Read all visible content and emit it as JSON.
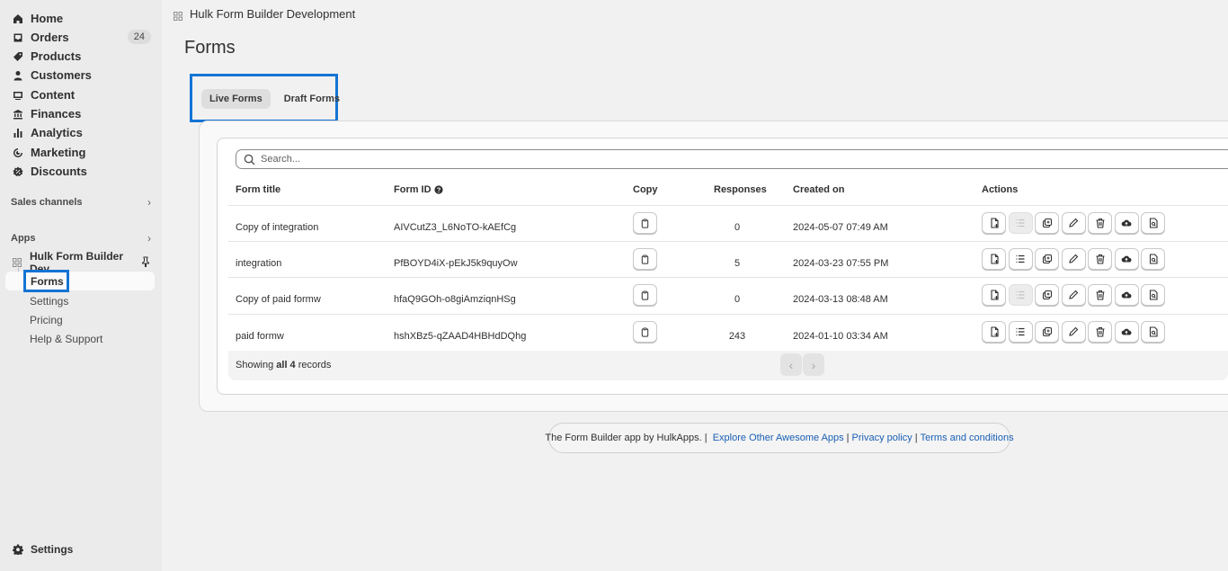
{
  "sidebar": {
    "nav": [
      {
        "label": "Home",
        "icon": "home-icon"
      },
      {
        "label": "Orders",
        "icon": "inbox-icon",
        "badge": "24"
      },
      {
        "label": "Products",
        "icon": "tag-icon"
      },
      {
        "label": "Customers",
        "icon": "person-icon"
      },
      {
        "label": "Content",
        "icon": "content-icon"
      },
      {
        "label": "Finances",
        "icon": "bank-icon"
      },
      {
        "label": "Analytics",
        "icon": "bar-chart-icon"
      },
      {
        "label": "Marketing",
        "icon": "target-icon"
      },
      {
        "label": "Discounts",
        "icon": "discount-icon"
      }
    ],
    "sales_channels": "Sales channels",
    "apps": "Apps",
    "app_name": "Hulk Form Builder Dev...",
    "sub_items": [
      "Forms",
      "Settings",
      "Pricing",
      "Help & Support"
    ],
    "settings": "Settings"
  },
  "header": {
    "breadcrumb": "Hulk Form Builder Development",
    "title": "Forms"
  },
  "tabs": [
    "Live Forms",
    "Draft Forms"
  ],
  "search": {
    "placeholder": "Search..."
  },
  "table": {
    "headers": [
      "Form title",
      "Form ID",
      "Copy",
      "Responses",
      "Created on",
      "Actions"
    ],
    "rows": [
      {
        "title": "Copy of integration",
        "form_id": "AIVCutZ3_L6NoTO-kAEfCg",
        "responses": "0",
        "created": "2024-05-07 07:49 AM",
        "list_disabled": true
      },
      {
        "title": "integration",
        "form_id": "PfBOYD4iX-pEkJ5k9quyOw",
        "responses": "5",
        "created": "2024-03-23 07:55 PM",
        "list_disabled": false
      },
      {
        "title": "Copy of paid formw",
        "form_id": "hfaQ9GOh-o8giAmziqnHSg",
        "responses": "0",
        "created": "2024-03-13 08:48 AM",
        "list_disabled": true
      },
      {
        "title": "paid formw",
        "form_id": "hshXBz5-qZAAD4HBHdDQhg",
        "responses": "243",
        "created": "2024-01-10 03:34 AM",
        "list_disabled": false
      }
    ],
    "footer_prefix": "Showing ",
    "footer_bold": "all 4",
    "footer_suffix": " records"
  },
  "credits": {
    "text": "The Form Builder app by HulkApps. |",
    "link1": "Explore Other Awesome Apps",
    "link2": "Privacy policy",
    "link3": "Terms and conditions",
    "sep": "|"
  },
  "colors": {
    "accent": "#1474d4",
    "link": "#1a5fb4"
  }
}
